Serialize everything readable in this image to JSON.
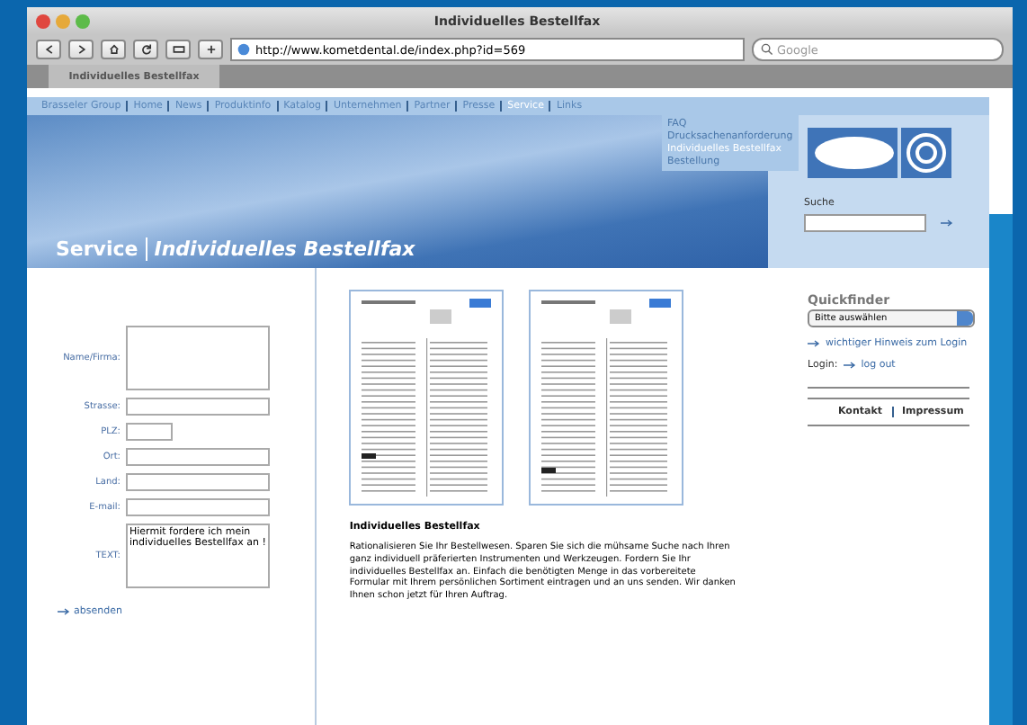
{
  "window": {
    "title": "Individuelles Bestellfax",
    "url": "http://www.kometdental.de/index.php?id=569",
    "search_placeholder": "Google",
    "tab": "Individuelles Bestellfax"
  },
  "nav": [
    {
      "label": "Brasseler Group",
      "selected": false
    },
    {
      "label": "Home",
      "selected": false
    },
    {
      "label": "News",
      "selected": false
    },
    {
      "label": "Produktinfo",
      "selected": false
    },
    {
      "label": "Katalog",
      "selected": false
    },
    {
      "label": "Unternehmen",
      "selected": false
    },
    {
      "label": "Partner",
      "selected": false
    },
    {
      "label": "Presse",
      "selected": false
    },
    {
      "label": "Service",
      "selected": true
    },
    {
      "label": "Links",
      "selected": false
    }
  ],
  "dropdown": [
    {
      "label": "FAQ",
      "selected": false
    },
    {
      "label": "Drucksachenanforderung",
      "selected": false
    },
    {
      "label": "Individuelles Bestellfax",
      "selected": true
    },
    {
      "label": "Bestellung",
      "selected": false
    }
  ],
  "banner": {
    "section": "Service",
    "page": "Individuelles Bestellfax",
    "search_label": "Suche"
  },
  "form": {
    "fields": [
      {
        "label": "Name/Firma:",
        "kind": "textarea"
      },
      {
        "label": "Strasse:",
        "kind": "input"
      },
      {
        "label": "PLZ:",
        "kind": "short"
      },
      {
        "label": "Ort:",
        "kind": "input"
      },
      {
        "label": "Land:",
        "kind": "input"
      },
      {
        "label": "E-mail:",
        "kind": "input"
      },
      {
        "label": "TEXT:",
        "kind": "textarea",
        "value": "Hiermit fordere ich mein individuelles Bestellfax an !"
      }
    ],
    "submit": "absenden"
  },
  "article": {
    "title": "Individuelles Bestellfax",
    "text": "Rationalisieren Sie Ihr Bestellwesen. Sparen Sie sich die mühsame Suche nach Ihren ganz individuell präferierten Instrumenten und Werkzeugen. Fordern Sie Ihr individuelles Bestellfax an. Einfach die benötigten Menge in das vorbereitete Formular mit Ihrem persönlichen Sortiment eintragen und an uns senden. Wir danken Ihnen schon jetzt für Ihren Auftrag."
  },
  "sidebar": {
    "quickfinder": "Quickfinder",
    "select": "Bitte auswählen",
    "hint_link": "wichtiger Hinweis zum Login",
    "login_label": "Login:",
    "logout": "log out",
    "footer": [
      "Kontakt",
      "Impressum"
    ]
  }
}
